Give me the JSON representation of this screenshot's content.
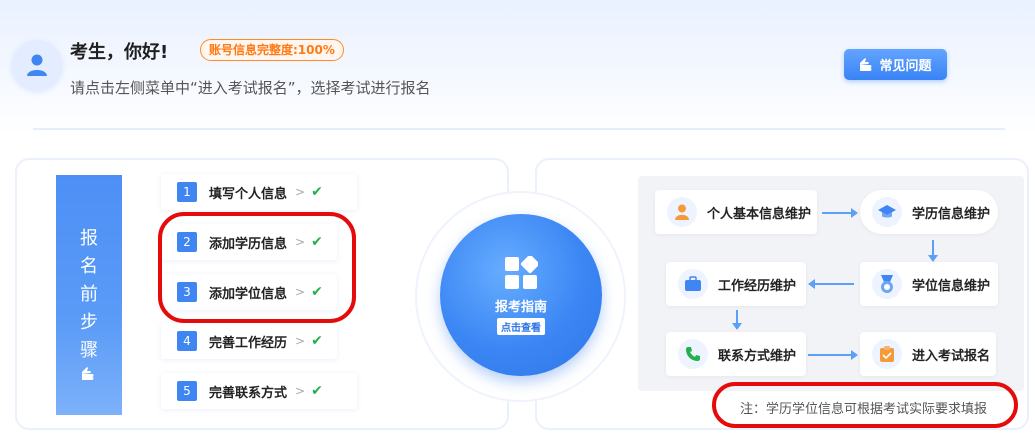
{
  "header": {
    "greeting": "考生，你好!",
    "completeness_badge": "账号信息完整度:100%",
    "hint": "请点击左侧菜单中“进入考试报名”，选择考试进行报名",
    "faq_label": "常见问题"
  },
  "steps_banner": {
    "chars": [
      "报",
      "名",
      "前",
      "步",
      "骤"
    ]
  },
  "steps": [
    {
      "num": "1",
      "label": "填写个人信息"
    },
    {
      "num": "2",
      "label": "添加学历信息"
    },
    {
      "num": "3",
      "label": "添加学位信息"
    },
    {
      "num": "4",
      "label": "完善工作经历"
    },
    {
      "num": "5",
      "label": "完善联系方式"
    }
  ],
  "guide": {
    "title": "报考指南",
    "button": "点击查看"
  },
  "flow": {
    "personal": "个人基本信息维护",
    "education": "学历信息维护",
    "degree": "学位信息维护",
    "work": "工作经历维护",
    "contact": "联系方式维护",
    "enter": "进入考试报名"
  },
  "note": "注：学历学位信息可根据考试实际要求填报",
  "colors": {
    "accent": "#3f86f2",
    "badge_orange": "#ff7a15",
    "check_green": "#22b14c",
    "highlight_red": "#e60b0b"
  }
}
